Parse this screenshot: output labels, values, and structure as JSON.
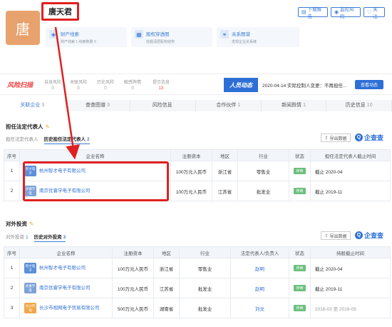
{
  "header": {
    "avatar_text": "唐",
    "person_name": "唐天君",
    "buttons": {
      "download": "下载报告",
      "monitor": "监控风险",
      "follow": "关注"
    },
    "cards": [
      {
        "title": "财产线索",
        "sub": "财产线索 1  线索数量 5"
      },
      {
        "title": "股权穿透图",
        "sub": "挖掘深层股权结构"
      },
      {
        "title": "关系图谱",
        "sub": "发现企业关系链"
      }
    ]
  },
  "risk": {
    "logo": "风险扫描",
    "stats": [
      {
        "label": "自身风险",
        "value": "0"
      },
      {
        "label": "关联风险",
        "value": "0"
      },
      {
        "label": "历史风险",
        "value": "0"
      },
      {
        "label": "敏感舆情",
        "value": "0"
      },
      {
        "label": "提示信息",
        "value": "13"
      }
    ],
    "news_label": "人员动态",
    "news_text": "2020-04-14 实际控制人变更：不再担任...",
    "view_button": "查看动态"
  },
  "tabs": [
    {
      "label": "关联企业",
      "count": "3"
    },
    {
      "label": "查查图谱",
      "count": "3"
    },
    {
      "label": "风险信息",
      "count": ""
    },
    {
      "label": "合作伙伴",
      "count": "1"
    },
    {
      "label": "新闻舆情",
      "count": "1"
    },
    {
      "label": "历史信息",
      "count": "10"
    }
  ],
  "legal_rep": {
    "title": "担任法定代表人",
    "subtabs": [
      {
        "label": "担任法定代表人",
        "count": ""
      },
      {
        "label": "历史担任法定代表人",
        "count": "2"
      }
    ],
    "export_label": "导出数据",
    "brand": "企查查",
    "columns": [
      "序号",
      "企业名称",
      "注册资本",
      "地区",
      "行业",
      "状态",
      "担任法定代表人截止时间"
    ],
    "rows": [
      {
        "index": "1",
        "logo": "智才电子",
        "logo_color": "#5b8fd9",
        "name": "杭州智才电子有限公司",
        "capital": "100万元人民币",
        "region": "浙江省",
        "industry": "零售业",
        "status": "存续",
        "end": "截止 2020-04"
      },
      {
        "index": "2",
        "logo": "优睿学电",
        "logo_color": "#7ea2d8",
        "name": "南京优睿学电子有限公司",
        "capital": "100万元人民币",
        "region": "江苏省",
        "industry": "批发业",
        "status": "存续",
        "end": "截止 2019-11"
      }
    ]
  },
  "investment": {
    "title": "对外投资",
    "subtabs": [
      {
        "label": "对外投资",
        "count": "1"
      },
      {
        "label": "历史对外投资",
        "count": "3"
      }
    ],
    "export_label": "导出数据",
    "brand": "企查查",
    "columns": [
      "序号",
      "企业名称",
      "注册资本",
      "地区",
      "行业",
      "法定代表人/负责人",
      "状态",
      "持股截止时间"
    ],
    "rows": [
      {
        "index": "1",
        "logo": "智才电子",
        "logo_color": "#5b8fd9",
        "name": "杭州智才电子有限公司",
        "capital": "100万元人民币",
        "region": "浙江省",
        "industry": "零售业",
        "rep": "赵明",
        "status": "存续",
        "end": "截止 2020-04"
      },
      {
        "index": "2",
        "logo": "优睿学电",
        "logo_color": "#7ea2d8",
        "name": "南京优睿学电子有限公司",
        "capital": "100万元人民币",
        "region": "江苏省",
        "industry": "批发业",
        "rep": "赵明",
        "status": "存续",
        "end": "截止 2019-11"
      },
      {
        "index": "3",
        "logo": "长沙市视",
        "logo_color": "#f0a84a",
        "name": "长沙市视网电子贸易有限公司",
        "capital": "500万元人民币",
        "region": "湖南省",
        "industry": "批发业",
        "rep": "刘文",
        "status": "存续",
        "end": "2016-03 至 2019-05"
      }
    ]
  },
  "colors": {
    "accent": "#2d6fd6",
    "highlight": "#e02020",
    "status_green": "#6cbf7d"
  }
}
